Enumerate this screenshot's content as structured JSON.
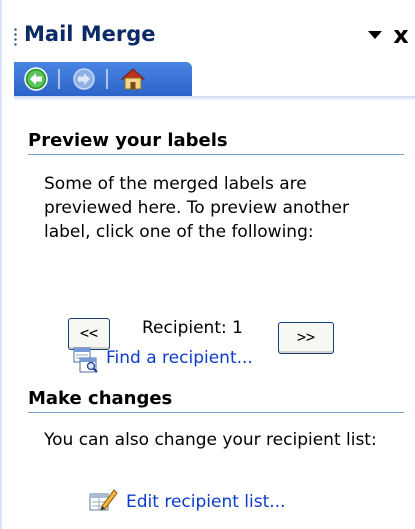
{
  "pane": {
    "title": "Mail Merge",
    "dropdown_icon": "triangle-down-icon",
    "close_label": "x"
  },
  "nav": {
    "back_icon": "back-arrow-icon",
    "forward_icon": "forward-arrow-icon",
    "home_icon": "home-icon"
  },
  "preview": {
    "header": "Preview your labels",
    "description": "Some of the merged labels are previewed here. To preview another label, click one of the following:",
    "prev_label": "<<",
    "recipient_text": "Recipient: 1",
    "next_label": ">>",
    "find_link": "Find a recipient..."
  },
  "changes": {
    "header": "Make changes",
    "description": "You can also change your recipient list:",
    "edit_link": "Edit recipient list..."
  },
  "colors": {
    "title": "#0c2a66",
    "toolbar": "#2c63c8",
    "link": "#0a3cce",
    "rule": "#7a9fd7"
  }
}
